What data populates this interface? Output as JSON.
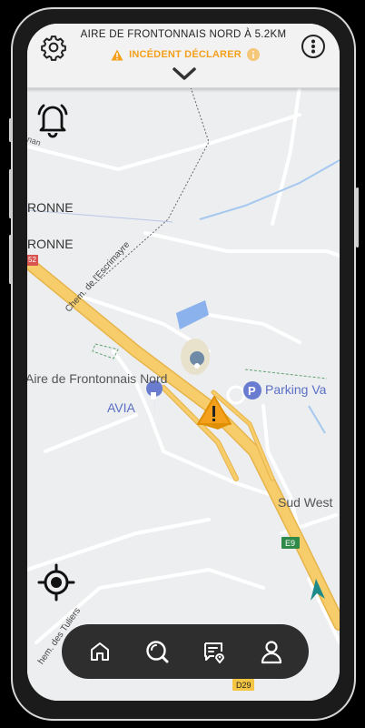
{
  "header": {
    "destination": "AIRE DE FRONTONNAIS NORD À 5.2KM",
    "incident_label": "INCÉDENT DÉCLARER"
  },
  "map": {
    "labels": {
      "ronne1": "RONNE",
      "ronne2": "RONNE",
      "road_52": "52",
      "chem_escrimayre": "Chem. de l'Escrimayre",
      "aire": "Aire de Frontonnais Nord",
      "avia": "AVIA",
      "parking": "Parking Va",
      "sud_west": "Sud West",
      "e9": "E9",
      "d29": "D29",
      "chem_tuliers": "hem. des Tuliers",
      "top_road": "nan"
    }
  },
  "icons": [
    "settings-icon",
    "more-vert-icon",
    "warning-icon",
    "info-icon",
    "chevron-down-icon",
    "bell-icon",
    "locate-icon",
    "home-icon",
    "search-icon",
    "report-location-icon",
    "profile-icon"
  ],
  "colors": {
    "accent": "#f4a01c",
    "nav_bg": "#2e2e2e",
    "highway": "#f6cd6a"
  }
}
